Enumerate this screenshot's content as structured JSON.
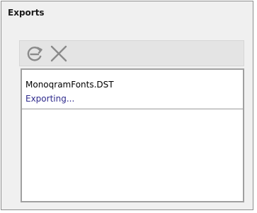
{
  "panel": {
    "title": "Exports"
  },
  "toolbar": {
    "buttons": [
      {
        "icon": "refresh-icon"
      },
      {
        "icon": "cancel-icon"
      }
    ]
  },
  "exports": {
    "items": [
      {
        "file_name": "MonoqramFonts.DST",
        "status": "Exporting..."
      }
    ]
  },
  "colors": {
    "status_text": "#2e2a8c",
    "icon_gray": "#8a8a8a"
  }
}
